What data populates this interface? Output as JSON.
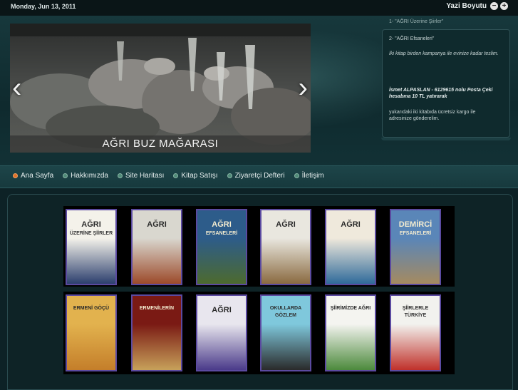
{
  "topbar": {
    "date": "Monday, Jun 13, 2011",
    "font_size_label": "Yazi Boyutu",
    "decrease_icon": "minus",
    "increase_icon": "plus"
  },
  "slider": {
    "caption": "AĞRI BUZ MAĞARASI",
    "prev_icon": "chevron-left-icon",
    "next_icon": "chevron-right-icon"
  },
  "sidebar": {
    "cut_line": "1- \"AĞRI Üzerine Şiirler\"",
    "item2": "2- \"AĞRI Efsaneleri\"",
    "campaign": "İki kitap birden kampanya ile evinize kadar teslim.",
    "account": "İsmet ALPASLAN - 6129615 nolu Posta Çeki hesabına 10 TL yatırarak",
    "shipping": "yukarıdaki iki kitabıda ücretsiz kargo ile adresinize gönderelim."
  },
  "nav": [
    {
      "label": "Ana Sayfa",
      "active": true
    },
    {
      "label": "Hakkımızda",
      "active": false
    },
    {
      "label": "Site Haritası",
      "active": false
    },
    {
      "label": "Kitap Satışı",
      "active": false
    },
    {
      "label": "Ziyaretçi Defteri",
      "active": false
    },
    {
      "label": "İletişim",
      "active": false
    }
  ],
  "books": {
    "row1": [
      {
        "title": "AĞRI",
        "subtitle": "ÜZERİNE ŞİİRLER",
        "colors": [
          "#f4f2ea",
          "#2c3f6e"
        ]
      },
      {
        "title": "AĞRI",
        "subtitle": "",
        "colors": [
          "#d9d7cf",
          "#9c4a2a"
        ]
      },
      {
        "title": "AĞRI",
        "subtitle": "EFSANELERİ",
        "colors": [
          "#2d5c8a",
          "#4d6a2e"
        ]
      },
      {
        "title": "AĞRI",
        "subtitle": "",
        "colors": [
          "#e9e7df",
          "#8a6a40"
        ]
      },
      {
        "title": "AĞRI",
        "subtitle": "",
        "colors": [
          "#efe9dc",
          "#2f6a9a"
        ]
      },
      {
        "title": "DEMİRCİ",
        "subtitle": "EFSANELERİ",
        "colors": [
          "#5a86b8",
          "#a58a60"
        ]
      }
    ],
    "row2": [
      {
        "title": "ERMENİ GÖÇÜ",
        "subtitle": "",
        "colors": [
          "#e2b24e",
          "#c47e2a"
        ]
      },
      {
        "title": "ERMENİLERİN",
        "subtitle": "",
        "colors": [
          "#7a1a14",
          "#c7a15a"
        ]
      },
      {
        "title": "AĞRI",
        "subtitle": "",
        "colors": [
          "#e8e6ee",
          "#4a3a8a"
        ]
      },
      {
        "title": "OKULLARDA",
        "subtitle": "GÖZLEM",
        "colors": [
          "#7fc8dc",
          "#2a2a2a"
        ]
      },
      {
        "title": "ŞİİRİMİZDE AĞRI",
        "subtitle": "",
        "colors": [
          "#f4f4f0",
          "#4c8a3c"
        ]
      },
      {
        "title": "ŞİİRLERLE",
        "subtitle": "TÜRKİYE",
        "colors": [
          "#f2f2ee",
          "#c0302a"
        ]
      }
    ]
  }
}
